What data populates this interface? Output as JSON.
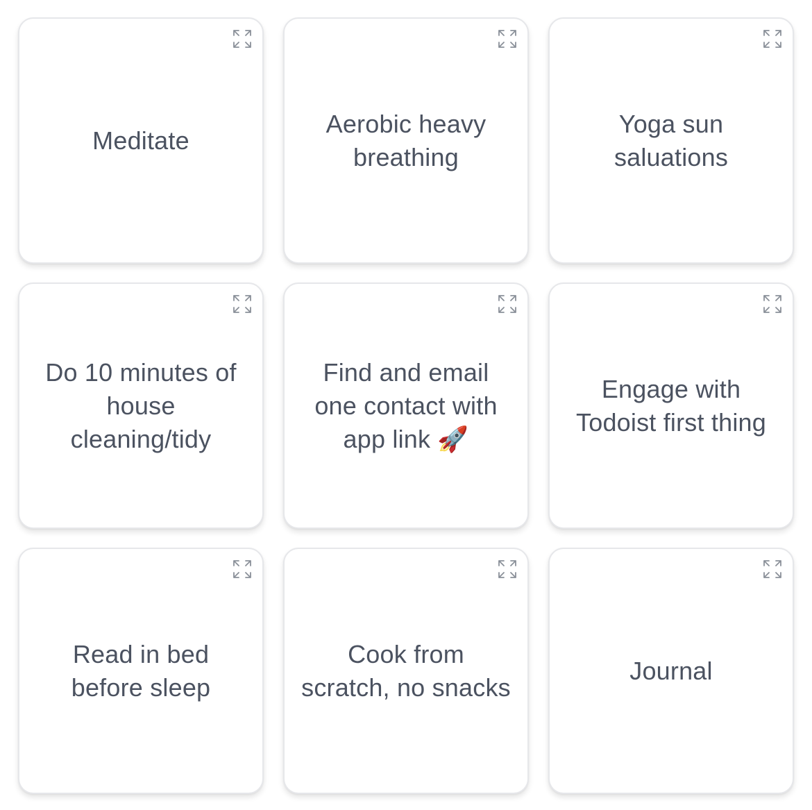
{
  "colors": {
    "card_border": "#e6e7ea",
    "card_text": "#4b5260",
    "icon": "#8a9099",
    "background": "#ffffff"
  },
  "cards": [
    {
      "text": "Meditate",
      "icon": "expand-icon"
    },
    {
      "text": "Aerobic heavy breathing",
      "icon": "expand-icon"
    },
    {
      "text": "Yoga sun saluations",
      "icon": "expand-icon"
    },
    {
      "text": "Do 10 minutes of house cleaning/tidy",
      "icon": "expand-icon"
    },
    {
      "text": "Find and email one contact with app link 🚀",
      "icon": "expand-icon"
    },
    {
      "text": "Engage with Todoist first thing",
      "icon": "expand-icon"
    },
    {
      "text": "Read in bed before sleep",
      "icon": "expand-icon"
    },
    {
      "text": "Cook from scratch, no snacks",
      "icon": "expand-icon"
    },
    {
      "text": "Journal",
      "icon": "expand-icon"
    }
  ]
}
